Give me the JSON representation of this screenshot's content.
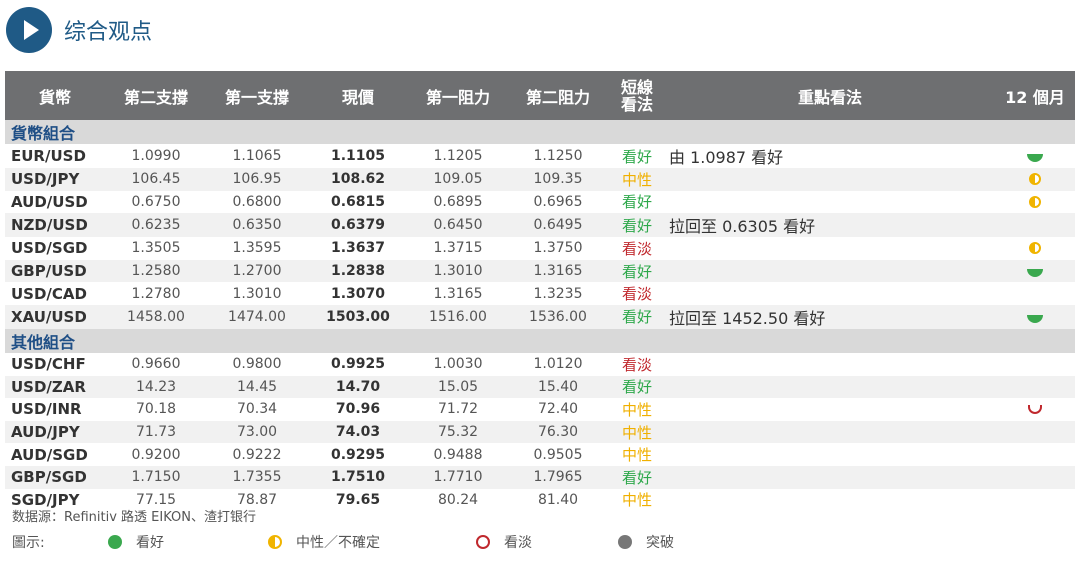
{
  "header": {
    "title": "综合观点"
  },
  "columns": [
    "貨幣",
    "第二支撐",
    "第一支撐",
    "現價",
    "第一阻力",
    "第二阻力",
    "短線看法",
    "重點看法",
    "12 個月"
  ],
  "columns_view": [
    "短線",
    "看法"
  ],
  "groups": [
    {
      "label": "貨幣組合",
      "rows": [
        {
          "pair": "EUR/USD",
          "s2": "1.0990",
          "s1": "1.1065",
          "cur": "1.1105",
          "r1": "1.1205",
          "r2": "1.1250",
          "view": "看好",
          "view_type": "bull",
          "note": "由 1.0987 看好",
          "outlook": "bull"
        },
        {
          "pair": "USD/JPY",
          "s2": "106.45",
          "s1": "106.95",
          "cur": "108.62",
          "r1": "109.05",
          "r2": "109.35",
          "view": "中性",
          "view_type": "neutral",
          "note": "",
          "outlook": "neutral"
        },
        {
          "pair": "AUD/USD",
          "s2": "0.6750",
          "s1": "0.6800",
          "cur": "0.6815",
          "r1": "0.6895",
          "r2": "0.6965",
          "view": "看好",
          "view_type": "bull",
          "note": "",
          "outlook": "neutral"
        },
        {
          "pair": "NZD/USD",
          "s2": "0.6235",
          "s1": "0.6350",
          "cur": "0.6379",
          "r1": "0.6450",
          "r2": "0.6495",
          "view": "看好",
          "view_type": "bull",
          "note": "拉回至 0.6305 看好",
          "outlook": ""
        },
        {
          "pair": "USD/SGD",
          "s2": "1.3505",
          "s1": "1.3595",
          "cur": "1.3637",
          "r1": "1.3715",
          "r2": "1.3750",
          "view": "看淡",
          "view_type": "bear",
          "note": "",
          "outlook": "neutral"
        },
        {
          "pair": "GBP/USD",
          "s2": "1.2580",
          "s1": "1.2700",
          "cur": "1.2838",
          "r1": "1.3010",
          "r2": "1.3165",
          "view": "看好",
          "view_type": "bull",
          "note": "",
          "outlook": "bull"
        },
        {
          "pair": "USD/CAD",
          "s2": "1.2780",
          "s1": "1.3010",
          "cur": "1.3070",
          "r1": "1.3165",
          "r2": "1.3235",
          "view": "看淡",
          "view_type": "bear",
          "note": "",
          "outlook": ""
        },
        {
          "pair": "XAU/USD",
          "s2": "1458.00",
          "s1": "1474.00",
          "cur": "1503.00",
          "r1": "1516.00",
          "r2": "1536.00",
          "view": "看好",
          "view_type": "bull",
          "note": "拉回至 1452.50 看好",
          "outlook": "bull"
        }
      ]
    },
    {
      "label": "其他組合",
      "rows": [
        {
          "pair": "USD/CHF",
          "s2": "0.9660",
          "s1": "0.9800",
          "cur": "0.9925",
          "r1": "1.0030",
          "r2": "1.0120",
          "view": "看淡",
          "view_type": "bear",
          "note": "",
          "outlook": ""
        },
        {
          "pair": "USD/ZAR",
          "s2": "14.23",
          "s1": "14.45",
          "cur": "14.70",
          "r1": "15.05",
          "r2": "15.40",
          "view": "看好",
          "view_type": "bull",
          "note": "",
          "outlook": ""
        },
        {
          "pair": "USD/INR",
          "s2": "70.18",
          "s1": "70.34",
          "cur": "70.96",
          "r1": "71.72",
          "r2": "72.40",
          "view": "中性",
          "view_type": "neutral",
          "note": "",
          "outlook": "bear"
        },
        {
          "pair": "AUD/JPY",
          "s2": "71.73",
          "s1": "73.00",
          "cur": "74.03",
          "r1": "75.32",
          "r2": "76.30",
          "view": "中性",
          "view_type": "neutral",
          "note": "",
          "outlook": ""
        },
        {
          "pair": "AUD/SGD",
          "s2": "0.9200",
          "s1": "0.9222",
          "cur": "0.9295",
          "r1": "0.9488",
          "r2": "0.9505",
          "view": "中性",
          "view_type": "neutral",
          "note": "",
          "outlook": ""
        },
        {
          "pair": "GBP/SGD",
          "s2": "1.7150",
          "s1": "1.7355",
          "cur": "1.7510",
          "r1": "1.7710",
          "r2": "1.7965",
          "view": "看好",
          "view_type": "bull",
          "note": "",
          "outlook": ""
        },
        {
          "pair": "SGD/JPY",
          "s2": "77.15",
          "s1": "78.87",
          "cur": "79.65",
          "r1": "80.24",
          "r2": "81.40",
          "view": "中性",
          "view_type": "neutral",
          "note": "",
          "outlook": ""
        }
      ]
    }
  ],
  "source": "数据源：Refinitiv 路透 EIKON、渣打银行",
  "legend": {
    "title": "圖示:",
    "items": [
      {
        "label": "看好",
        "type": "bull"
      },
      {
        "label": "中性／不確定",
        "type": "neutral"
      },
      {
        "label": "看淡",
        "type": "bear"
      },
      {
        "label": "突破",
        "type": "break"
      }
    ]
  },
  "colors": {
    "header_bg": "#6e6f71",
    "accent": "#1f5a86",
    "bull": "#2da84a",
    "neutral": "#f0b000",
    "bear": "#c0282d"
  }
}
